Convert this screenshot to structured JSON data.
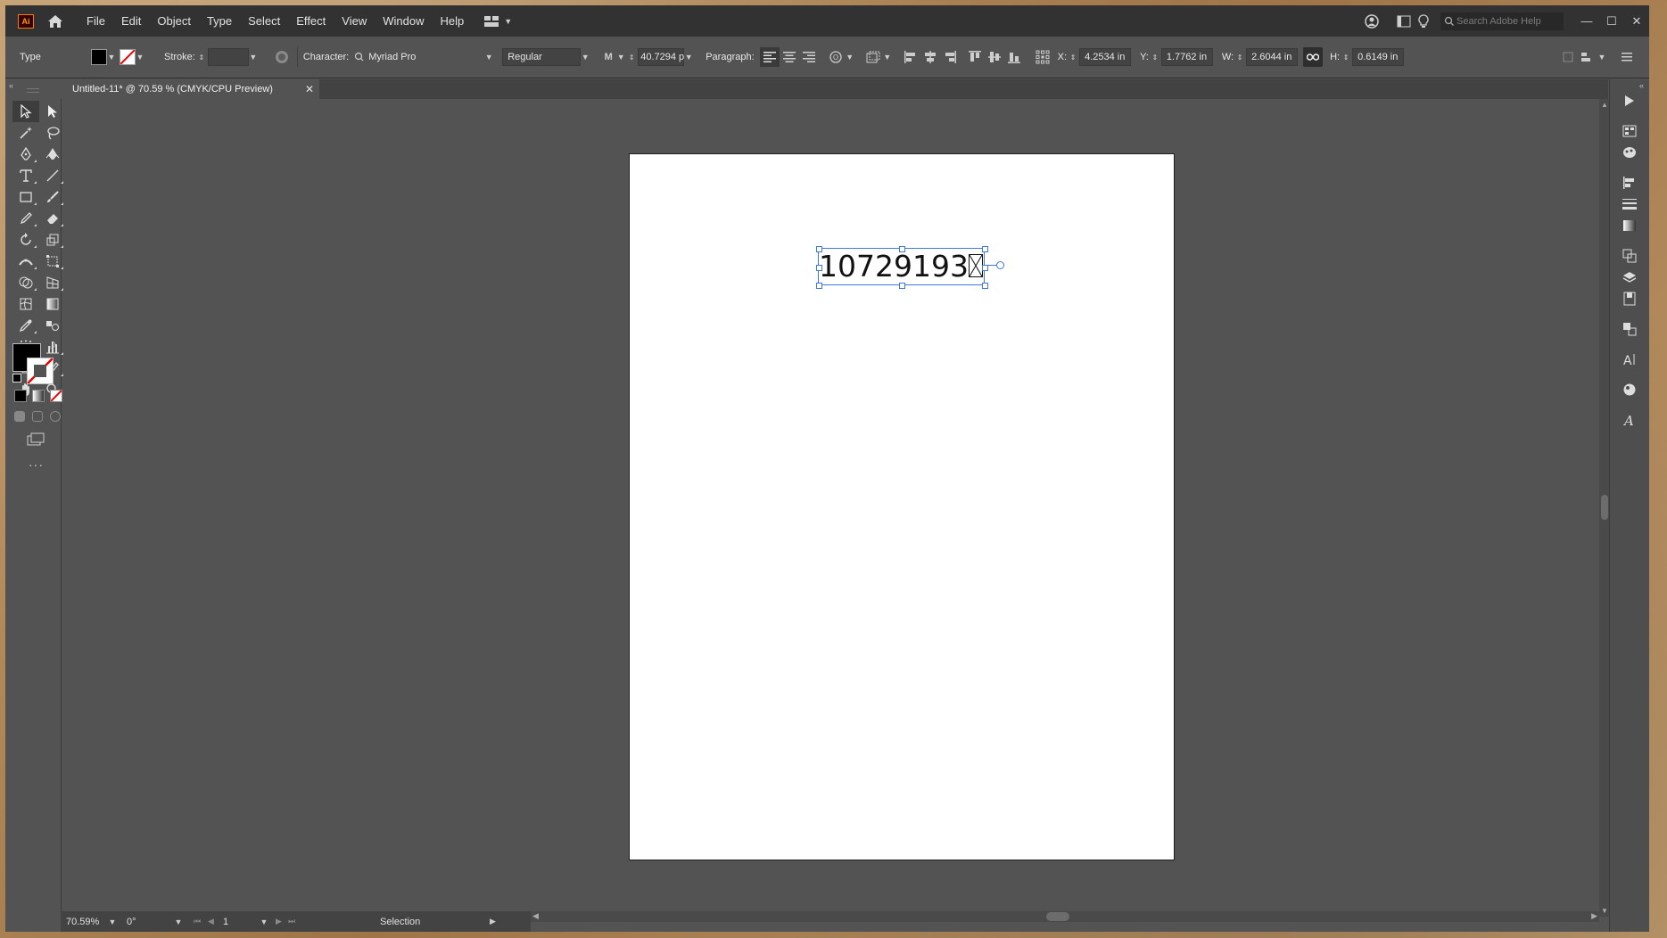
{
  "app": {
    "logo": "Ai"
  },
  "menu": [
    "File",
    "Edit",
    "Object",
    "Type",
    "Select",
    "Effect",
    "View",
    "Window",
    "Help"
  ],
  "search": {
    "placeholder": "Search Adobe Help"
  },
  "control": {
    "tool_label": "Type",
    "stroke_label": "Stroke:",
    "character_label": "Character:",
    "font_family": "Myriad Pro",
    "font_style": "Regular",
    "font_size": "40.7294 p",
    "paragraph_label": "Paragraph:",
    "x_label": "X:",
    "x_value": "4.2534 in",
    "y_label": "Y:",
    "y_value": "1.7762 in",
    "w_label": "W:",
    "w_value": "2.6044 in",
    "h_label": "H:",
    "h_value": "0.6149 in"
  },
  "document": {
    "tab_title": "Untitled-11* @ 70.59 % (CMYK/CPU Preview)",
    "text_content": "10729193"
  },
  "status": {
    "zoom": "70.59%",
    "rotation": "0°",
    "artboard": "1",
    "tool": "Selection"
  },
  "colors": {
    "accent": "#3e78d8",
    "chrome_dark": "#323232",
    "panel": "#535353"
  }
}
